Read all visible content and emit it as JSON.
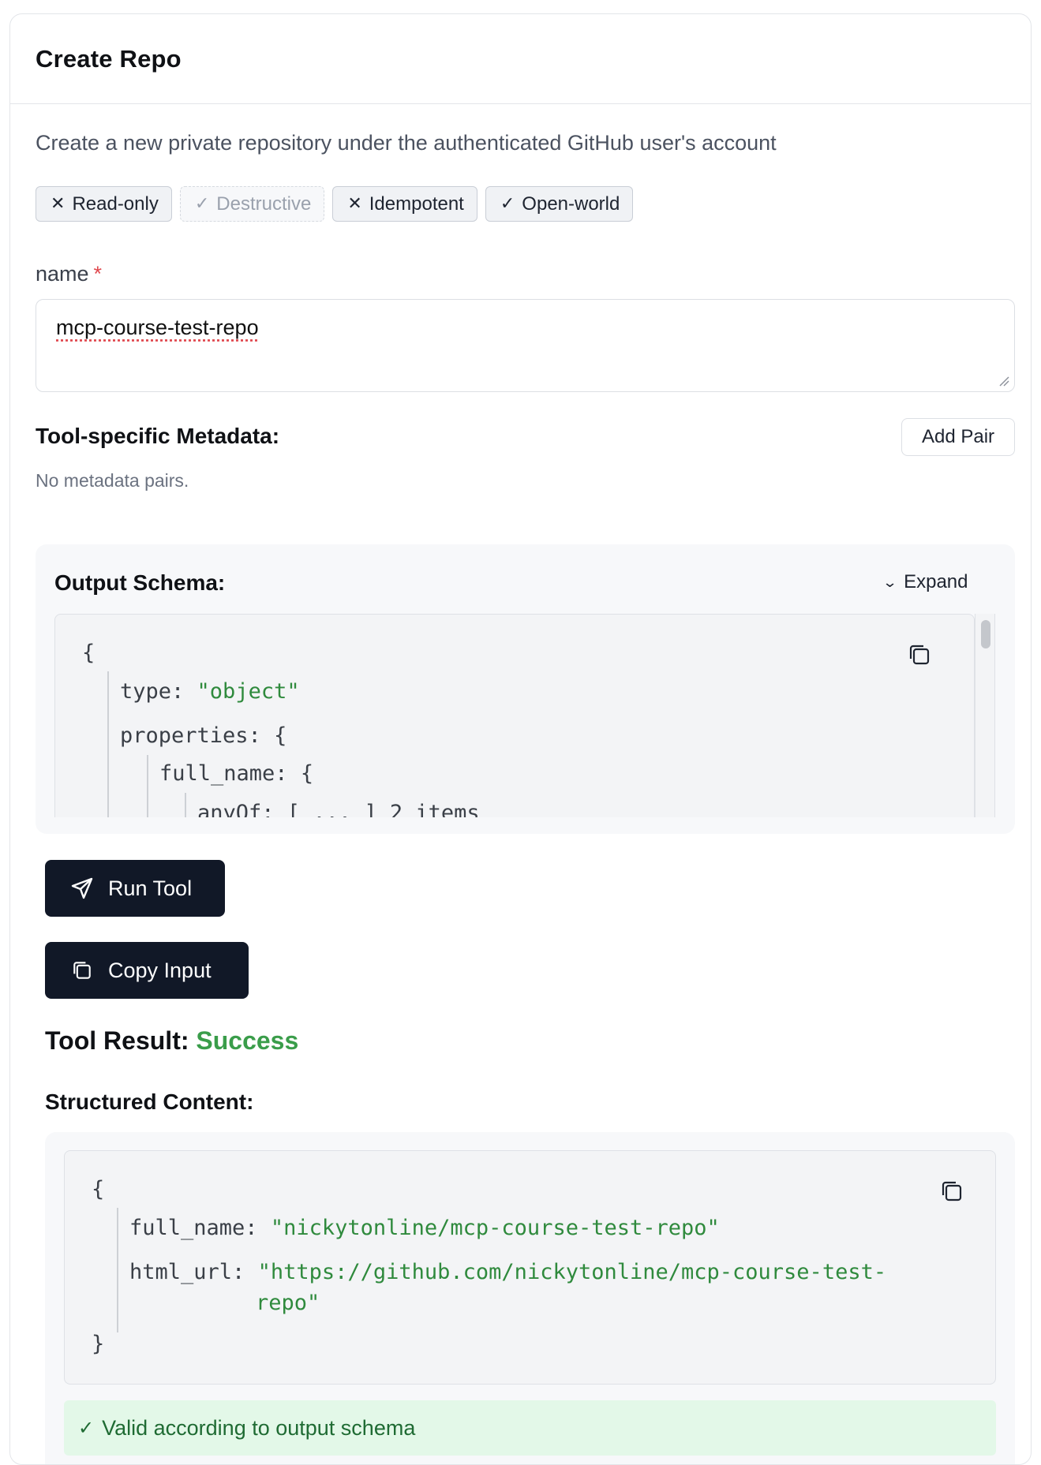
{
  "card": {
    "title": "Create Repo",
    "description": "Create a new private repository under the authenticated GitHub user's account"
  },
  "badges": [
    {
      "icon": "x-icon",
      "glyph": "✕",
      "label": "Read-only",
      "muted": false
    },
    {
      "icon": "check-icon",
      "glyph": "✓",
      "label": "Destructive",
      "muted": true
    },
    {
      "icon": "x-icon",
      "glyph": "✕",
      "label": "Idempotent",
      "muted": false
    },
    {
      "icon": "check-icon",
      "glyph": "✓",
      "label": "Open-world",
      "muted": false
    }
  ],
  "field": {
    "label": "name",
    "required_mark": "*",
    "value": "mcp-course-test-repo"
  },
  "metadata": {
    "title": "Tool-specific Metadata:",
    "add_label": "Add Pair",
    "empty_text": "No metadata pairs."
  },
  "output_schema": {
    "title": "Output Schema:",
    "expand_label": "Expand",
    "open_brace": "{",
    "lines": [
      {
        "key": "type:",
        "value": "\"object\""
      },
      {
        "key": "properties:",
        "value": "{"
      },
      {
        "key": "full_name:",
        "value": "{"
      },
      {
        "key": "anyOf:",
        "value": "[ ... ] 2 items"
      }
    ]
  },
  "buttons": {
    "run": "Run Tool",
    "copy": "Copy Input"
  },
  "result": {
    "label": "Tool Result:",
    "status": "Success",
    "status_color": "#3a9d4a",
    "structured_title": "Structured Content:",
    "open_brace": "{",
    "close_brace": "}",
    "full_name_key": "full_name:",
    "full_name_value": "\"nickytonline/mcp-course-test-repo\"",
    "html_url_key": "html_url:",
    "html_url_value_1": "\"https://github.com/nickytonline/mcp-course-test-",
    "html_url_value_2": "repo\"",
    "valid_text": "Valid according to output schema"
  },
  "colors": {
    "dark_button": "#111827",
    "string_green": "#2f8a3d",
    "valid_bg": "#e3f8e8"
  }
}
